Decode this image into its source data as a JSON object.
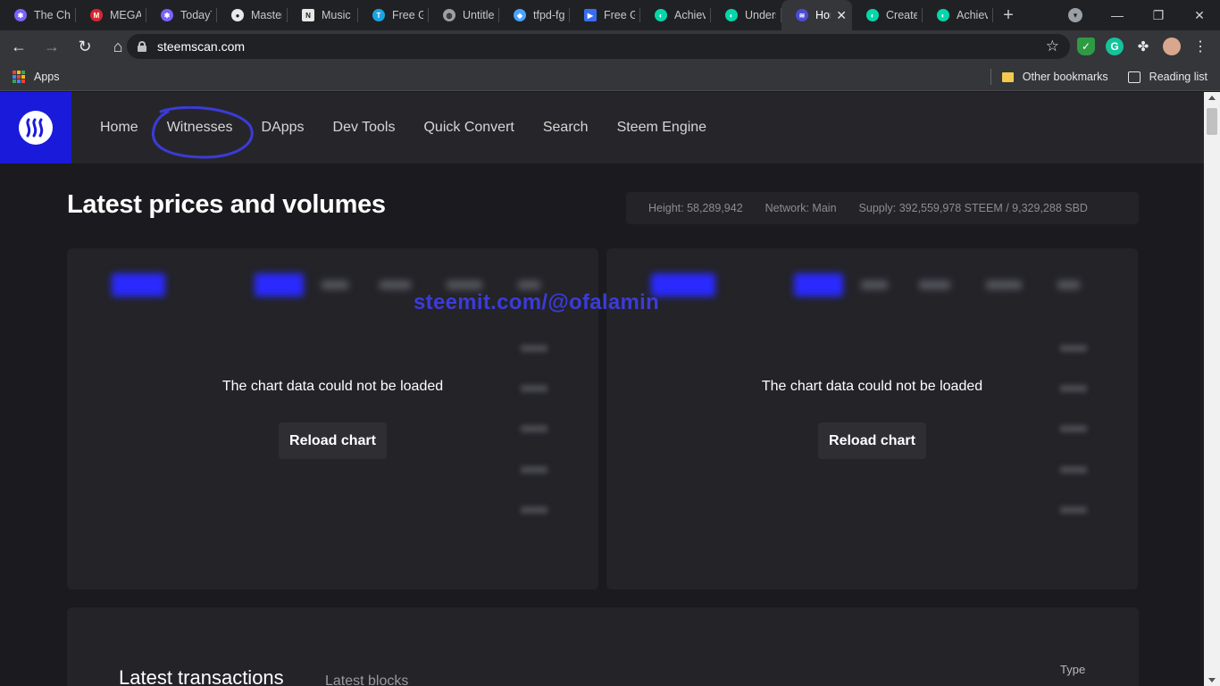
{
  "browser": {
    "tabs": [
      {
        "label": "The Ch",
        "icon": "graph-icon",
        "color": "#7b61ff"
      },
      {
        "label": "MEGA",
        "icon": "mega-icon",
        "color": "#d9272e"
      },
      {
        "label": "TodayT",
        "icon": "graph-icon",
        "color": "#7b61ff"
      },
      {
        "label": "Master",
        "icon": "github-icon",
        "color": "#e8e8e8"
      },
      {
        "label": "Music",
        "icon": "notion-icon",
        "color": "#e8e8e8"
      },
      {
        "label": "Free G",
        "icon": "t-icon",
        "color": "#1ba3e3"
      },
      {
        "label": "Untitle",
        "icon": "globe-icon",
        "color": "#9aa0a6"
      },
      {
        "label": "tfpd-fg",
        "icon": "flutter-icon",
        "color": "#4aa3ff"
      },
      {
        "label": "Free G",
        "icon": "video-icon",
        "color": "#3a6cf0"
      },
      {
        "label": "Achiev",
        "icon": "steemit-icon",
        "color": "#06d6a9"
      },
      {
        "label": "Unders",
        "icon": "steemit-icon",
        "color": "#06d6a9"
      },
      {
        "label": "Hor",
        "icon": "steemscan-icon",
        "color": "#4b4bd6",
        "active": true
      },
      {
        "label": "Create",
        "icon": "steemit-icon",
        "color": "#06d6a9"
      },
      {
        "label": "Achiev",
        "icon": "steemit-icon",
        "color": "#06d6a9"
      }
    ],
    "url": "steemscan.com",
    "bookmarks": {
      "apps": "Apps",
      "other": "Other bookmarks",
      "reading": "Reading list"
    }
  },
  "site": {
    "nav": [
      "Home",
      "Witnesses",
      "DApps",
      "Dev Tools",
      "Quick Convert",
      "Search",
      "Steem Engine"
    ],
    "title": "Latest prices and volumes",
    "stats": {
      "height": "Height: 58,289,942",
      "network": "Network: Main",
      "supply": "Supply: 392,559,978 STEEM / 9,329,288 SBD"
    },
    "charts": [
      {
        "error": "The chart data could not be loaded",
        "button": "Reload chart"
      },
      {
        "error": "The chart data could not be loaded",
        "button": "Reload chart"
      }
    ],
    "watermark": "steemit.com/@ofalamin",
    "transactions": {
      "title": "Latest transactions",
      "tab2": "Latest blocks",
      "col_type": "Type"
    },
    "colors": {
      "brand": "#1a1adb",
      "annotation": "#3b3bd9"
    }
  }
}
